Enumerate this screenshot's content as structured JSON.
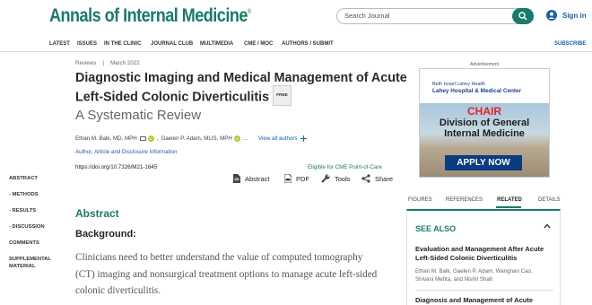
{
  "header": {
    "logo_main": "Annals of Internal Medicine",
    "logo_mark": "®",
    "search_placeholder": "Search Journal",
    "signin_label": "Sign in"
  },
  "nav": {
    "items": [
      "LATEST",
      "ISSUES",
      "IN THE CLINIC",
      "JOURNAL CLUB",
      "MULTIMEDIA",
      "CME / MOC",
      "AUTHORS / SUBMIT"
    ],
    "subscribe": "SUBSCRIBE"
  },
  "article": {
    "type": "Reviews",
    "date": "March 2022",
    "title": "Diagnostic Imaging and Medical Management of Acute Left-Sided Colonic Diverticulitis",
    "free_badge": "FREE",
    "subtitle": "A Systematic Review",
    "authors": [
      "Ethan M. Balk, MD, MPH",
      "Gaelen P. Adam, MLIS, MPH",
      "..."
    ],
    "view_all": "View all authors",
    "affiliation_link": "Author, Article and Disclosure Information",
    "doi": "https://doi.org/10.7326/M21-1645",
    "cme": "Eligible for CME Point-of-Care",
    "actions": [
      "Abstract",
      "PDF",
      "Tools",
      "Share"
    ]
  },
  "toc": [
    "ABSTRACT",
    "- METHODS",
    "- RESULTS",
    "- DISCUSSION",
    "COMMENTS",
    "SUPPLEMENTAL",
    "MATERIAL"
  ],
  "abstract": {
    "heading": "Abstract",
    "section": "Background:",
    "lines": [
      "Clinicians need to better understand the value of computed tomography",
      "(CT) imaging and nonsurgical treatment options to manage acute left-sided",
      "colonic diverticulitis."
    ]
  },
  "ad": {
    "label": "Advertisement",
    "org_line1": "Beth Israel Lahey Health",
    "org_line2": "Lahey Hospital & Medical Center",
    "chair": "CHAIR",
    "division_line1": "Division of General",
    "division_line2": "Internal Medicine",
    "button": "APPLY NOW"
  },
  "sidebar": {
    "tabs": [
      "FIGURES",
      "REFERENCES",
      "RELATED",
      "DETAILS"
    ],
    "active_tab": "RELATED",
    "see_also": "SEE ALSO",
    "related": [
      {
        "title": "Evaluation and Management After Acute Left-Sided Colonic Diverticulitis",
        "authors": "Ethan M. Balk, Gaelen P. Adam, Wangnan Cao, Shivani Mehta, and Nishit Shah"
      },
      {
        "title": "Diagnosis and Management of Acute",
        "authors": ""
      }
    ]
  },
  "colors": {
    "brand": "#1a7a6b",
    "link": "#1a5fa8",
    "ad_red": "#e2242b",
    "ad_blue": "#0b3b80"
  }
}
